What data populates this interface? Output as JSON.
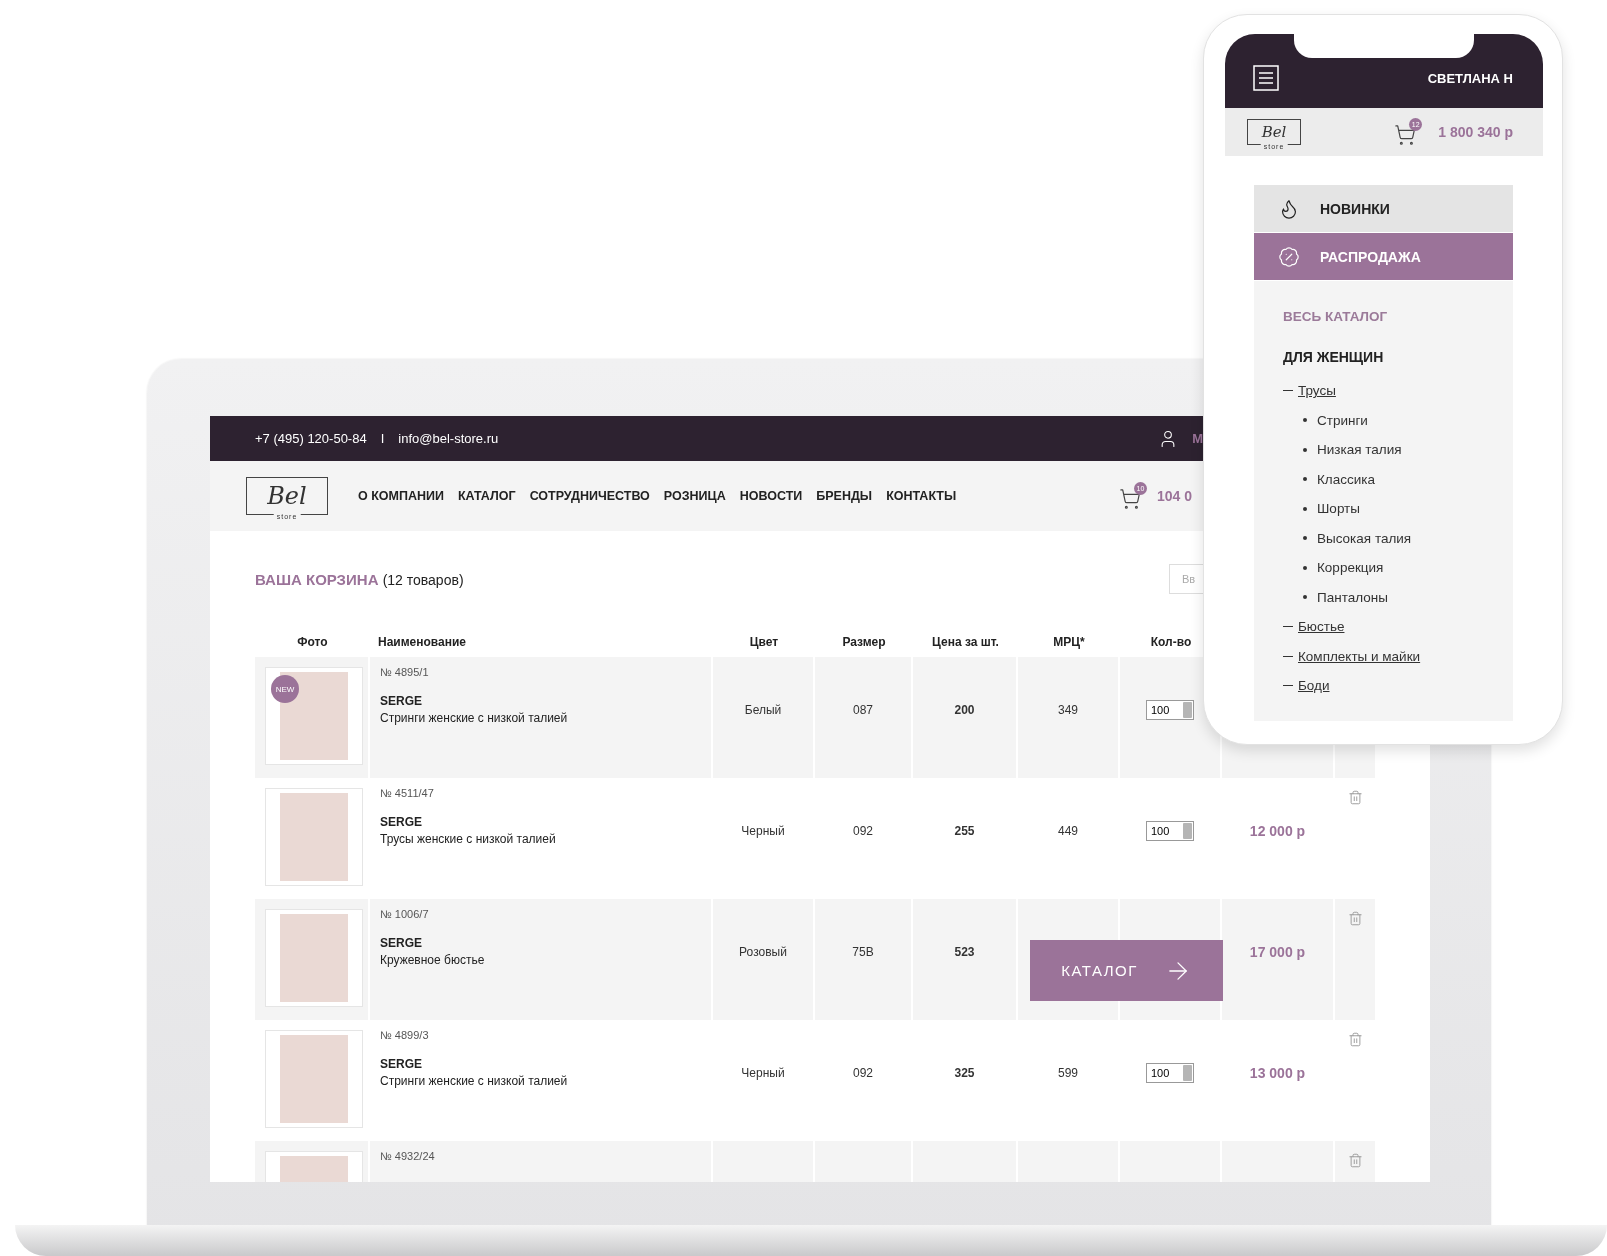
{
  "laptop": {
    "topbar": {
      "phone": "+7 (495) 120-50-84",
      "separator": "I",
      "email": "info@bel-store.ru",
      "user_label": "М"
    },
    "header": {
      "logo": {
        "text": "Bel",
        "sub": "store"
      },
      "menu": [
        "О КОМПАНИИ",
        "КАТАЛОГ",
        "СОТРУДНИЧЕСТВО",
        "РОЗНИЦА",
        "НОВОСТИ",
        "БРЕНДЫ",
        "КОНТАКТЫ"
      ],
      "cart_count": "10",
      "cart_total": "104 0"
    },
    "cart": {
      "title": "ВАША КОРЗИНА",
      "count": "(12 товаров)",
      "search_placeholder": "Вв",
      "columns": [
        "Фото",
        "Наименование",
        "Цвет",
        "Размер",
        "Цена за шт.",
        "МРЦ*",
        "Кол-во"
      ],
      "rows": [
        {
          "badge": "NEW",
          "number": "№ 4895/1",
          "brand": "SERGE",
          "name": "Стринги женские с низкой талией",
          "shade": "Белый",
          "size": "087",
          "price": "200",
          "mrc": "349",
          "qty": "100"
        },
        {
          "number": "№ 4511/47",
          "brand": "SERGE",
          "name": "Трусы женские с низкой талией",
          "shade": "Черный",
          "size": "092",
          "price": "255",
          "mrc": "449",
          "qty": "100",
          "total": "12 000 р"
        },
        {
          "number": "№ 1006/7",
          "brand": "SERGE",
          "name": "Кружевное бюстье",
          "shade": "Розовый",
          "size": "75B",
          "price": "523",
          "total": "17 000 р"
        },
        {
          "number": "№ 4899/3",
          "brand": "SERGE",
          "name": "Стринги женские с низкой талией",
          "shade": "Черный",
          "size": "092",
          "price": "325",
          "mrc": "599",
          "qty": "100",
          "total": "13 000 р"
        },
        {
          "number": "№ 4932/24"
        }
      ]
    },
    "catalog_button": {
      "label": "КАТАЛОГ"
    }
  },
  "phone": {
    "user_name": "СВЕТЛАНА Н",
    "logo": {
      "text": "Bel",
      "sub": "store"
    },
    "cart_count": "12",
    "cart_total": "1 800 340 р",
    "menu": [
      {
        "kind": "new",
        "label": "НОВИНКИ",
        "selected": false
      },
      {
        "kind": "sale",
        "label": "РАСПРОДАЖА",
        "selected": true
      }
    ],
    "catalog_link": "ВЕСЬ КАТАЛОГ",
    "section": "ДЛЯ ЖЕНЩИН",
    "tree": [
      {
        "label": "Трусы",
        "children": [
          {
            "label": "Стринги"
          },
          {
            "label": "Низкая талия"
          },
          {
            "label": "Классика"
          },
          {
            "label": "Шорты"
          },
          {
            "label": "Высокая талия"
          },
          {
            "label": "Коррекция"
          },
          {
            "label": "Панталоны"
          }
        ]
      },
      {
        "label": "Бюстье"
      },
      {
        "label": "Комплекты и майки"
      },
      {
        "label": "Боди"
      }
    ]
  }
}
